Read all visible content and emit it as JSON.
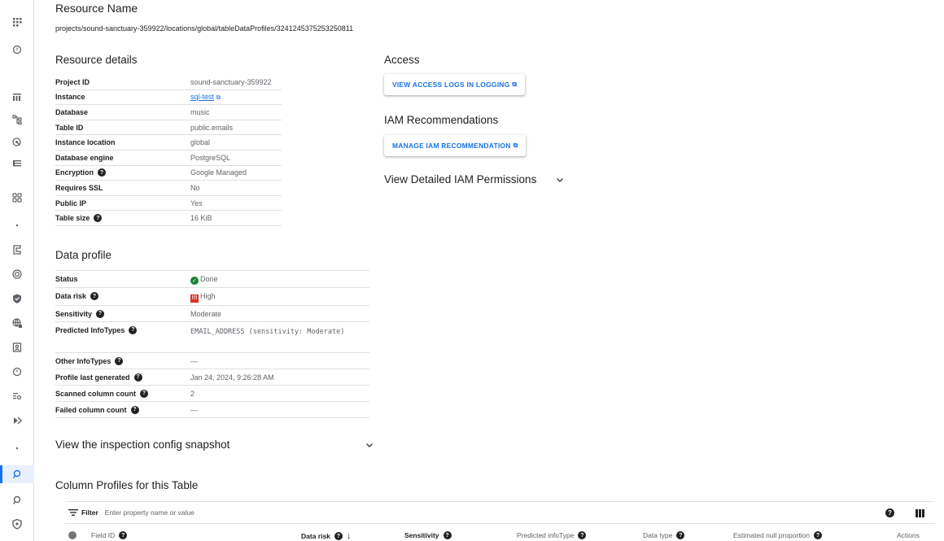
{
  "rail": {
    "icons": [
      "apps-icon",
      "shield-icon",
      "dashboard-icon",
      "hierarchy-icon",
      "radar-icon",
      "list-icon",
      "grid-icon",
      "dot-icon",
      "tag-icon",
      "target-icon",
      "shield-check-icon",
      "globe-icon",
      "badge-icon",
      "info-shield-icon",
      "search-list-icon",
      "sensitivity-icon",
      "dot-icon",
      "profile-icon",
      "profile-search-icon",
      "security-shield-icon"
    ],
    "active_index": 17
  },
  "resource": {
    "title": "Resource Name",
    "path": "projects/sound-sanctuary-359922/locations/global/tableDataProfiles/3241245375253250811"
  },
  "details": {
    "title": "Resource details",
    "rows": [
      {
        "key": "Project ID",
        "value": "sound-sanctuary-359922"
      },
      {
        "key": "Instance",
        "value": "sql-test"
      },
      {
        "key": "Database",
        "value": "music"
      },
      {
        "key": "Table ID",
        "value": "public.emails"
      },
      {
        "key": "Instance location",
        "value": "global"
      },
      {
        "key": "Database engine",
        "value": "PostgreSQL"
      },
      {
        "key": "Encryption",
        "value": "Google Managed"
      },
      {
        "key": "Requires SSL",
        "value": "No"
      },
      {
        "key": "Public IP",
        "value": "Yes"
      },
      {
        "key": "Table size",
        "value": "16 KiB"
      }
    ]
  },
  "access": {
    "title": "Access",
    "logs_button": "VIEW ACCESS LOGS IN LOGGING",
    "iam_title": "IAM Recommendations",
    "iam_button": "MANAGE IAM RECOMMENDATION",
    "iam_permissions": "View Detailed IAM Permissions"
  },
  "profile": {
    "title": "Data profile",
    "rows": [
      {
        "key": "Status",
        "value": "Done"
      },
      {
        "key": "Data risk",
        "value": "High"
      },
      {
        "key": "Sensitivity",
        "value": "Moderate"
      },
      {
        "key": "Predicted InfoTypes",
        "value": "EMAIL_ADDRESS (sensitivity: Moderate)"
      },
      {
        "key": "Other InfoTypes",
        "value": "—"
      },
      {
        "key": "Profile last generated",
        "value": "Jan 24, 2024, 9:26:28 AM"
      },
      {
        "key": "Scanned column count",
        "value": "2"
      },
      {
        "key": "Failed column count",
        "value": "—"
      }
    ]
  },
  "inspection": {
    "label": "View the inspection config snapshot"
  },
  "columns": {
    "title": "Column Profiles for this Table",
    "filter_label": "Filter",
    "filter_placeholder": "Enter property name or value",
    "headers": {
      "field_id": "Field ID",
      "data_risk": "Data risk",
      "sensitivity": "Sensitivity",
      "predicted": "Predicted infoType",
      "data_type": "Data type",
      "null_prop": "Estimated null proportion",
      "actions": "Actions"
    }
  }
}
